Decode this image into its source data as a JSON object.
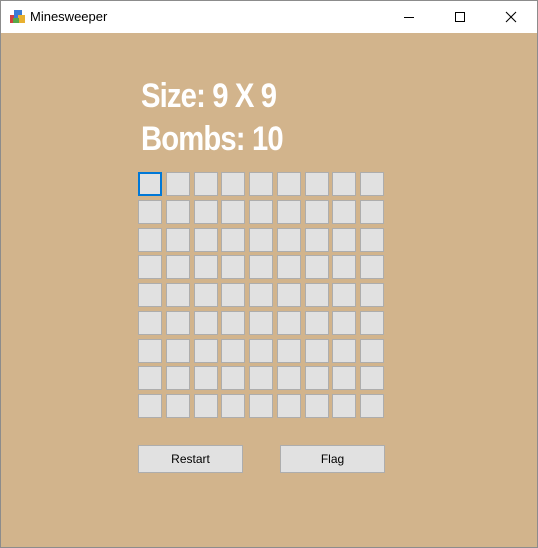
{
  "window": {
    "title": "Minesweeper",
    "app_icon": "minesweeper-app-icon",
    "controls": {
      "minimize_icon": "minimize-icon",
      "maximize_icon": "maximize-icon",
      "close_icon": "close-icon"
    }
  },
  "game": {
    "size_label": "Size: 9 X 9",
    "bombs_label": "Bombs: 10",
    "grid": {
      "rows": 9,
      "cols": 9,
      "focused_cell": [
        0,
        0
      ]
    }
  },
  "buttons": {
    "restart_label": "Restart",
    "flag_label": "Flag"
  },
  "colors": {
    "background": "#d2b48c",
    "cell": "#e1e1e1",
    "cell_border": "#adadad",
    "focus": "#0078d7",
    "heading_text": "#ffffff"
  }
}
